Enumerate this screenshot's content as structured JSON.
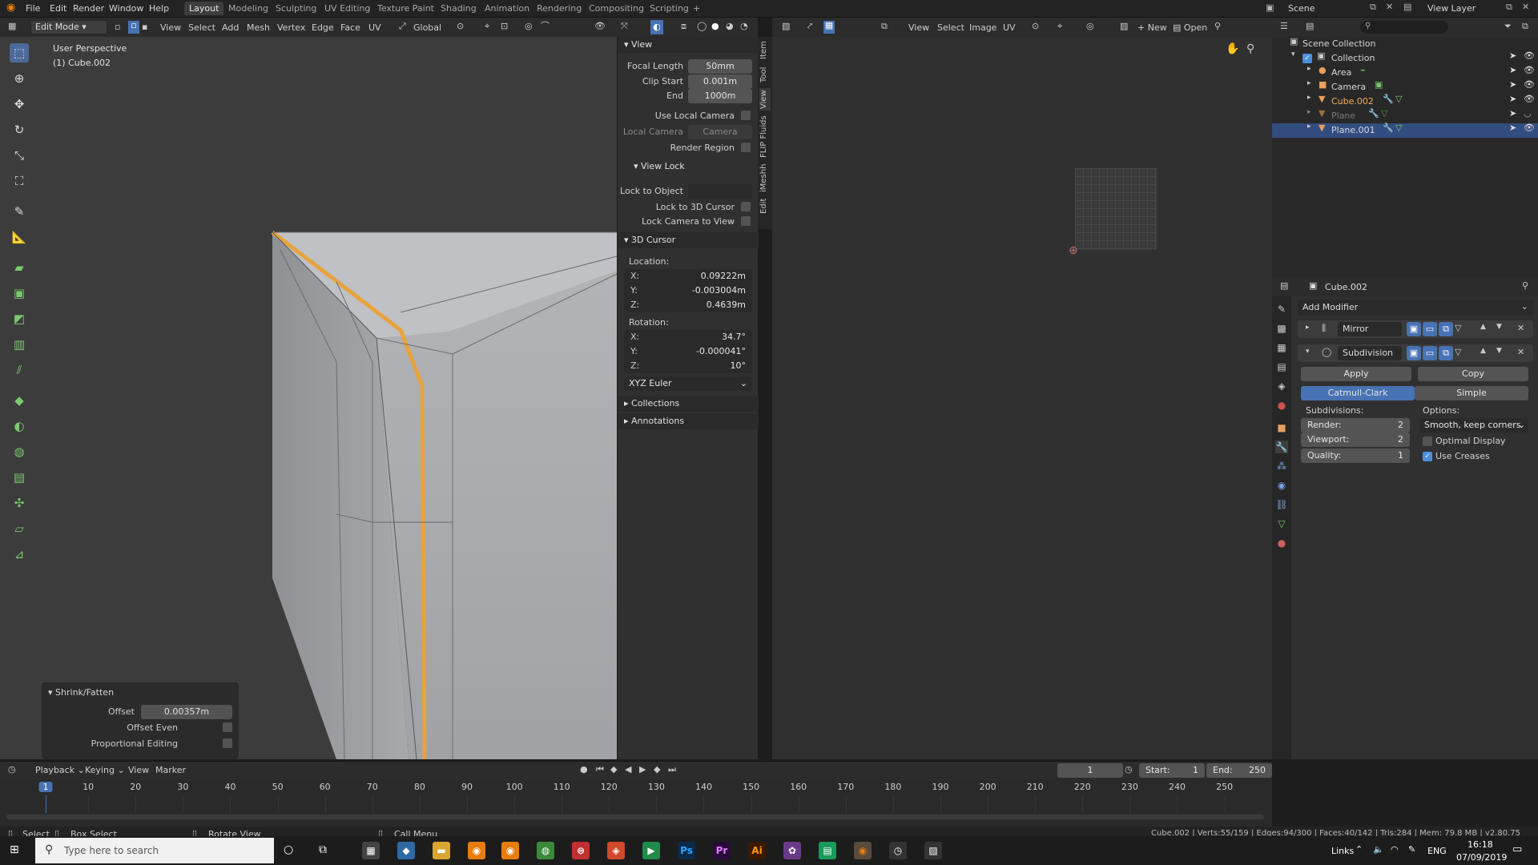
{
  "menu": {
    "items": [
      "File",
      "Edit",
      "Render",
      "Window",
      "Help"
    ]
  },
  "workspaces": [
    "Layout",
    "Modeling",
    "Sculpting",
    "UV Editing",
    "Texture Paint",
    "Shading",
    "Animation",
    "Rendering",
    "Compositing",
    "Scripting",
    "+"
  ],
  "scene": {
    "label": "Scene",
    "view_layer": "View Layer"
  },
  "viewport": {
    "mode": "Edit Mode",
    "header_menus": [
      "View",
      "Select",
      "Add",
      "Mesh",
      "Vertex",
      "Edge",
      "Face",
      "UV"
    ],
    "orientation": "Global",
    "overlay_title": "User Perspective",
    "overlay_object": "(1) Cube.002"
  },
  "npanel": {
    "tabs": [
      "Item",
      "Tool",
      "View",
      "FLIP Fluids",
      "iMeshh",
      "Edit"
    ],
    "view": {
      "title": "View",
      "focal_length_label": "Focal Length",
      "focal_length": "50mm",
      "clip_start_label": "Clip Start",
      "clip_start": "0.001m",
      "end_label": "End",
      "end": "1000m",
      "use_local_camera": "Use Local Camera",
      "local_camera": "Local Camera",
      "camera": "Camera",
      "render_region": "Render Region"
    },
    "view_lock": {
      "title": "View Lock",
      "lock_to_object": "Lock to Object",
      "lock_to_cursor": "Lock to 3D Cursor",
      "lock_camera": "Lock Camera to View"
    },
    "cursor": {
      "title": "3D Cursor",
      "location": "Location:",
      "loc_x": "0.09222m",
      "loc_y": "-0.003004m",
      "loc_z": "0.4639m",
      "rotation": "Rotation:",
      "rot_x": "34.7°",
      "rot_y": "-0.000041°",
      "rot_z": "10°",
      "mode": "XYZ Euler",
      "x": "X:",
      "y": "Y:",
      "z": "Z:"
    },
    "collections": "Collections",
    "annotations": "Annotations"
  },
  "redo_panel": {
    "title": "Shrink/Fatten",
    "offset_label": "Offset",
    "offset": "0.00357m",
    "offset_even": "Offset Even",
    "proportional": "Proportional Editing"
  },
  "image_editor": {
    "menus": [
      "View",
      "Select",
      "Image",
      "UV"
    ],
    "new": "New",
    "open": "Open"
  },
  "outliner": {
    "rows": [
      {
        "label": "Scene Collection"
      },
      {
        "label": "Collection"
      },
      {
        "label": "Area"
      },
      {
        "label": "Camera"
      },
      {
        "label": "Cube.002"
      },
      {
        "label": "Plane"
      },
      {
        "label": "Plane.001"
      }
    ]
  },
  "properties": {
    "object": "Cube.002",
    "add_modifier": "Add Modifier",
    "mirror": "Mirror",
    "subdivision": "Subdivision",
    "apply": "Apply",
    "copy": "Copy",
    "catmull": "Catmull-Clark",
    "simple": "Simple",
    "subdivisions": "Subdivisions:",
    "options": "Options:",
    "render_label": "Render:",
    "render": "2",
    "viewport_label": "Viewport:",
    "viewport": "2",
    "quality_label": "Quality:",
    "quality": "1",
    "uv_smooth": "Smooth, keep corners",
    "optimal_display": "Optimal Display",
    "use_creases": "Use Creases"
  },
  "timeline": {
    "menus": [
      "Playback",
      "Keying",
      "View",
      "Marker"
    ],
    "current": "1",
    "start_label": "Start:",
    "start": "1",
    "end_label": "End:",
    "end": "250",
    "ticks": [
      "1",
      "10",
      "20",
      "30",
      "40",
      "50",
      "60",
      "70",
      "80",
      "90",
      "100",
      "110",
      "120",
      "130",
      "140",
      "150",
      "160",
      "170",
      "180",
      "190",
      "200",
      "210",
      "220",
      "230",
      "240",
      "250"
    ]
  },
  "statusbar": {
    "select": "Select",
    "box_select": "Box Select",
    "rotate": "Rotate View",
    "call_menu": "Call Menu",
    "stats": "Cube.002 | Verts:55/159 | Edges:94/300 | Faces:40/142 | Tris:284 | Mem: 79.8 MB | v2.80.75"
  },
  "taskbar": {
    "search": "Type here to search",
    "links": "Links",
    "lang": "ENG",
    "time": "16:18",
    "date": "07/09/2019"
  },
  "colors": {
    "accent": "#4772b3",
    "selected_edge": "#e8a33d",
    "outliner_sel": "#334d80"
  }
}
